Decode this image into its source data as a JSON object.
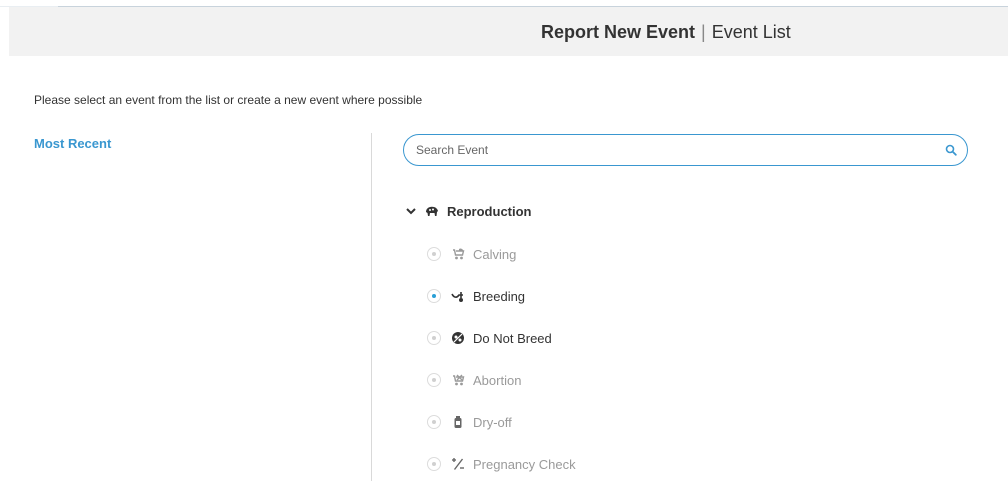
{
  "header": {
    "active_tab": "Report New Event",
    "separator": "|",
    "other_tab": "Event List"
  },
  "instruction": "Please select an event from the list or create a new event where possible",
  "sidebar": {
    "most_recent": "Most Recent"
  },
  "search": {
    "placeholder": "Search Event",
    "icon": "search-icon"
  },
  "group": {
    "label": "Reproduction",
    "icon": "cow-icon",
    "expanded": true
  },
  "events": [
    {
      "label": "Calving",
      "icon": "stroller-icon",
      "enabled": false,
      "selected": false
    },
    {
      "label": "Breeding",
      "icon": "breeding-icon",
      "enabled": true,
      "selected": true
    },
    {
      "label": "Do Not Breed",
      "icon": "do-not-breed-icon",
      "enabled": true,
      "selected": false
    },
    {
      "label": "Abortion",
      "icon": "abortion-icon",
      "enabled": false,
      "selected": false
    },
    {
      "label": "Dry-off",
      "icon": "bottle-icon",
      "enabled": false,
      "selected": false
    },
    {
      "label": "Pregnancy Check",
      "icon": "pregnancy-check-icon",
      "enabled": false,
      "selected": false
    }
  ],
  "colors": {
    "accent": "#3a97d0",
    "selected_dot": "#2a9fd6",
    "disabled_text": "#9a9a9a",
    "header_bg": "#f2f2f2"
  }
}
